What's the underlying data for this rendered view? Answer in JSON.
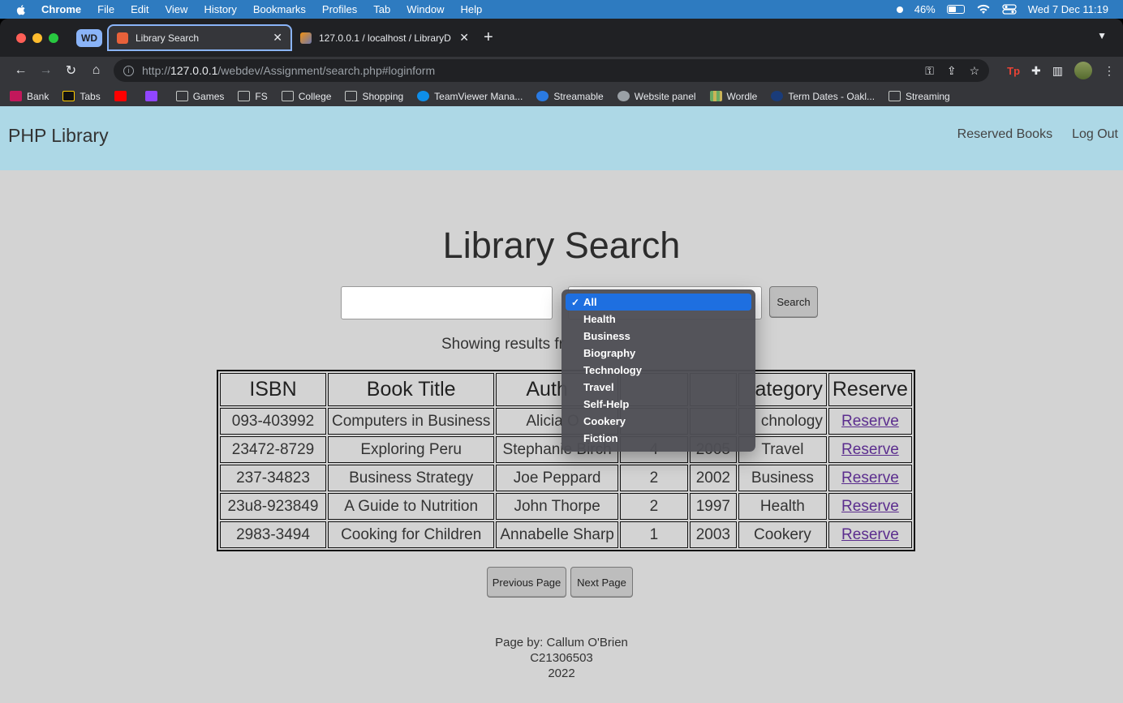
{
  "menubar": {
    "app": "Chrome",
    "items": [
      "File",
      "Edit",
      "View",
      "History",
      "Bookmarks",
      "Profiles",
      "Tab",
      "Window",
      "Help"
    ],
    "battery": "46%",
    "datetime": "Wed 7 Dec  11:19"
  },
  "browser": {
    "tab_group": "WD",
    "tabs": [
      {
        "title": "Library Search",
        "active": true
      },
      {
        "title": "127.0.0.1 / localhost / LibraryD",
        "active": false
      }
    ],
    "url_prefix": "http://",
    "url_host": "127.0.0.1",
    "url_path": "/webdev/Assignment/search.php#loginform",
    "bookmarks": [
      "Bank",
      "Tabs",
      "",
      "",
      "Games",
      "FS",
      "College",
      "Shopping",
      "TeamViewer Mana...",
      "Streamable",
      "Website panel",
      "Wordle",
      "Term Dates - Oakl...",
      "Streaming"
    ]
  },
  "page": {
    "brand": "PHP Library",
    "nav": {
      "reserved": "Reserved Books",
      "logout": "Log Out"
    },
    "title": "Library Search",
    "search_value": "",
    "search_button": "Search",
    "showing_text": "Showing results fr",
    "table": {
      "headers": [
        "ISBN",
        "Book Title",
        "Auth",
        "",
        "",
        "ategory",
        "Reserve"
      ],
      "rows": [
        [
          "093-403992",
          "Computers in Business",
          "Alicia O",
          "",
          "",
          "chnology",
          "Reserve"
        ],
        [
          "23472-8729",
          "Exploring Peru",
          "Stephanie Birch",
          "4",
          "2005",
          "Travel",
          "Reserve"
        ],
        [
          "237-34823",
          "Business Strategy",
          "Joe Peppard",
          "2",
          "2002",
          "Business",
          "Reserve"
        ],
        [
          "23u8-923849",
          "A Guide to Nutrition",
          "John Thorpe",
          "2",
          "1997",
          "Health",
          "Reserve"
        ],
        [
          "2983-3494",
          "Cooking for Children",
          "Annabelle Sharp",
          "1",
          "2003",
          "Cookery",
          "Reserve"
        ]
      ]
    },
    "prev_button": "Previous Page",
    "next_button": "Next Page",
    "footer": {
      "line1": "Page by: Callum O'Brien",
      "line2": "C21306503",
      "line3": "2022"
    },
    "category_options": [
      "All",
      "Health",
      "Business",
      "Biography",
      "Technology",
      "Travel",
      "Self-Help",
      "Cookery",
      "Fiction"
    ],
    "category_selected": "All"
  },
  "colors": {
    "navbar": "#add8e6",
    "page_bg": "#d3d3d3",
    "menubar": "#2e7bc0",
    "select_highlight": "#1e6fe0"
  }
}
